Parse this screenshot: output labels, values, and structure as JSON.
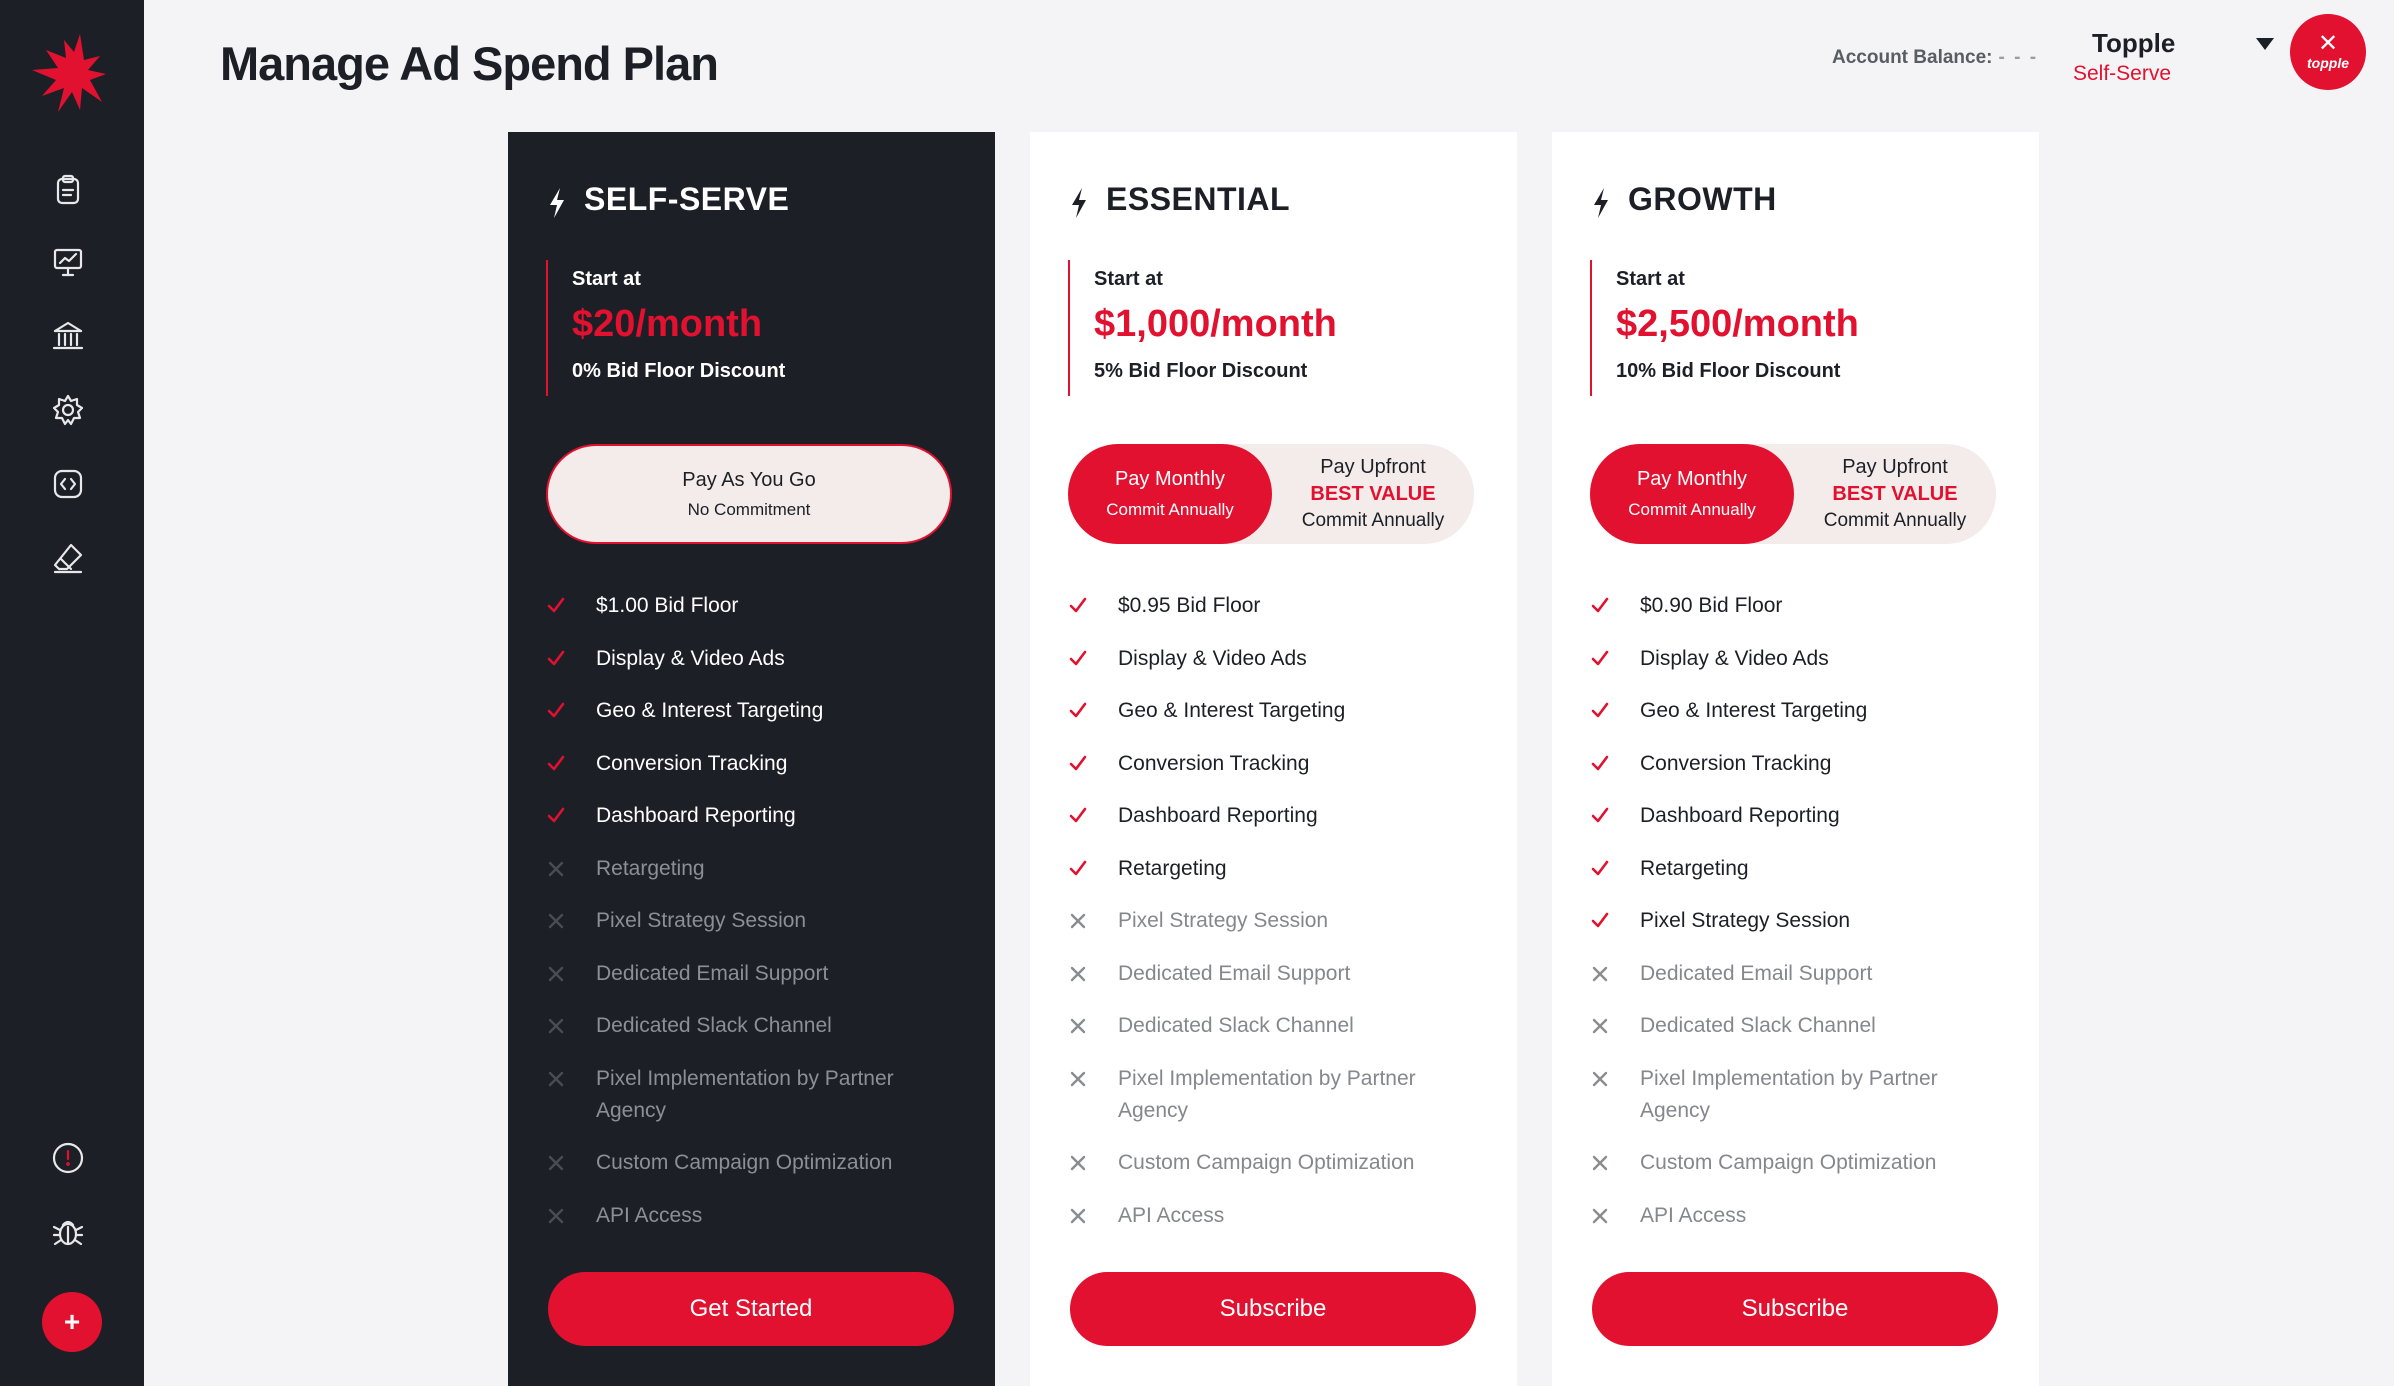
{
  "header": {
    "title": "Manage Ad Spend Plan",
    "balance_label": "Account Balance:",
    "balance_value": "- - -",
    "account_name": "Topple",
    "account_plan": "Self-Serve",
    "avatar_text": "topple"
  },
  "sidebar": {
    "items": [
      {
        "icon": "clipboard-icon"
      },
      {
        "icon": "presentation-chart-icon"
      },
      {
        "icon": "bank-icon"
      },
      {
        "icon": "settings-gear-icon"
      },
      {
        "icon": "code-icon"
      },
      {
        "icon": "eraser-icon"
      },
      {
        "icon": "alert-icon"
      },
      {
        "icon": "bug-icon"
      }
    ],
    "add_label": "+"
  },
  "colors": {
    "accent": "#e1112f",
    "sidebar": "#1d1f27",
    "background": "#f4f4f6"
  },
  "plans": [
    {
      "name": "SELF-SERVE",
      "start_label": "Start at",
      "price": "$20/month",
      "discount": "0% Bid Floor Discount",
      "payment": {
        "line1": "Pay As You Go",
        "line2": "No Commitment"
      },
      "cta": "Get Started",
      "features": [
        {
          "label": "$1.00 Bid Floor",
          "included": true
        },
        {
          "label": "Display & Video Ads",
          "included": true
        },
        {
          "label": "Geo & Interest Targeting",
          "included": true
        },
        {
          "label": "Conversion Tracking",
          "included": true
        },
        {
          "label": "Dashboard Reporting",
          "included": true
        },
        {
          "label": "Retargeting",
          "included": false
        },
        {
          "label": "Pixel Strategy Session",
          "included": false
        },
        {
          "label": "Dedicated Email Support",
          "included": false
        },
        {
          "label": "Dedicated Slack Channel",
          "included": false
        },
        {
          "label": "Pixel Implementation by Partner Agency",
          "included": false
        },
        {
          "label": "Custom Campaign Optimization",
          "included": false
        },
        {
          "label": "API Access",
          "included": false
        }
      ]
    },
    {
      "name": "ESSENTIAL",
      "start_label": "Start at",
      "price": "$1,000/month",
      "discount": "5% Bid Floor Discount",
      "payment": {
        "left_line1": "Pay Monthly",
        "left_line2": "Commit Annually",
        "right_line1": "Pay Upfront",
        "right_line2": "BEST VALUE",
        "right_line3": "Commit Annually"
      },
      "cta": "Subscribe",
      "features": [
        {
          "label": "$0.95 Bid Floor",
          "included": true
        },
        {
          "label": "Display & Video Ads",
          "included": true
        },
        {
          "label": "Geo & Interest Targeting",
          "included": true
        },
        {
          "label": "Conversion Tracking",
          "included": true
        },
        {
          "label": "Dashboard Reporting",
          "included": true
        },
        {
          "label": "Retargeting",
          "included": true
        },
        {
          "label": "Pixel Strategy Session",
          "included": false
        },
        {
          "label": "Dedicated Email Support",
          "included": false
        },
        {
          "label": "Dedicated Slack Channel",
          "included": false
        },
        {
          "label": "Pixel Implementation by Partner Agency",
          "included": false
        },
        {
          "label": "Custom Campaign Optimization",
          "included": false
        },
        {
          "label": "API Access",
          "included": false
        }
      ]
    },
    {
      "name": "GROWTH",
      "start_label": "Start at",
      "price": "$2,500/month",
      "discount": "10% Bid Floor Discount",
      "payment": {
        "left_line1": "Pay Monthly",
        "left_line2": "Commit Annually",
        "right_line1": "Pay Upfront",
        "right_line2": "BEST VALUE",
        "right_line3": "Commit Annually"
      },
      "cta": "Subscribe",
      "features": [
        {
          "label": "$0.90 Bid Floor",
          "included": true
        },
        {
          "label": "Display & Video Ads",
          "included": true
        },
        {
          "label": "Geo & Interest Targeting",
          "included": true
        },
        {
          "label": "Conversion Tracking",
          "included": true
        },
        {
          "label": "Dashboard Reporting",
          "included": true
        },
        {
          "label": "Retargeting",
          "included": true
        },
        {
          "label": "Pixel Strategy Session",
          "included": true
        },
        {
          "label": "Dedicated Email Support",
          "included": false
        },
        {
          "label": "Dedicated Slack Channel",
          "included": false
        },
        {
          "label": "Pixel Implementation by Partner Agency",
          "included": false
        },
        {
          "label": "Custom Campaign Optimization",
          "included": false
        },
        {
          "label": "API Access",
          "included": false
        }
      ]
    }
  ]
}
